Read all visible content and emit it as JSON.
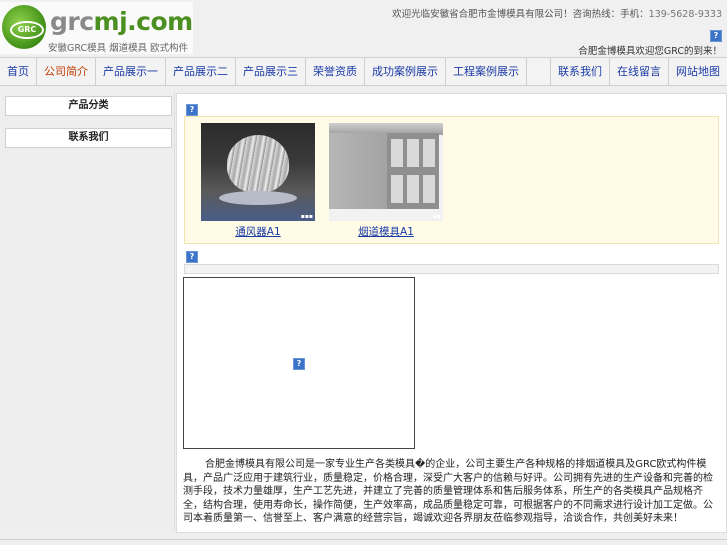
{
  "header": {
    "logo_domain_prefix": "grc",
    "logo_domain_suffix": "mj.com",
    "logo_badge": "GRC",
    "logo_subtitle": "安徽GRC模具  烟道模具  欧式构件",
    "notice": "欢迎光临安徽省合肥市金博模具有限公司！咨询热线：手机：",
    "phone": "139-5628-9333",
    "welcome": "合肥金博模具欢迎您GRC的到来！"
  },
  "nav": {
    "left": [
      "首页",
      "公司简介",
      "产品展示一",
      "产品展示二",
      "产品展示三",
      "荣誉资质",
      "成功案例展示",
      "工程案例展示"
    ],
    "right": [
      "联系我们",
      "在线留言",
      "网站地图"
    ],
    "active_index": 1
  },
  "sidebar": {
    "boxes": [
      "产品分类",
      "联系我们"
    ]
  },
  "products": [
    {
      "label": "通风器A1",
      "image": "turbine-ventilator-image"
    },
    {
      "label": "烟道模具A1",
      "image": "flue-mold-beam-image"
    }
  ],
  "article": "合肥金博模具有限公司是一家专业生产各类模具�的企业，公司主要生产各种规格的排烟道模具及GRC欧式构件模具，产品广泛应用于建筑行业，质量稳定，价格合理，深受广大客户的信赖与好评。公司拥有先进的生产设备和完善的检测手段，技术力量雄厚，生产工艺先进，并建立了完善的质量管理体系和售后服务体系，所生产的各类模具产品规格齐全，结构合理，使用寿命长，操作简便，生产效率高，成品质量稳定可靠，可根据客户的不同需求进行设计加工定做。公司本着质量第一、信誉至上、客户满意的经营宗旨，竭诚欢迎各界朋友莅临参观指导，洽谈合作，共创美好未来！",
  "icons": {
    "placeholder": "broken-image-icon"
  }
}
